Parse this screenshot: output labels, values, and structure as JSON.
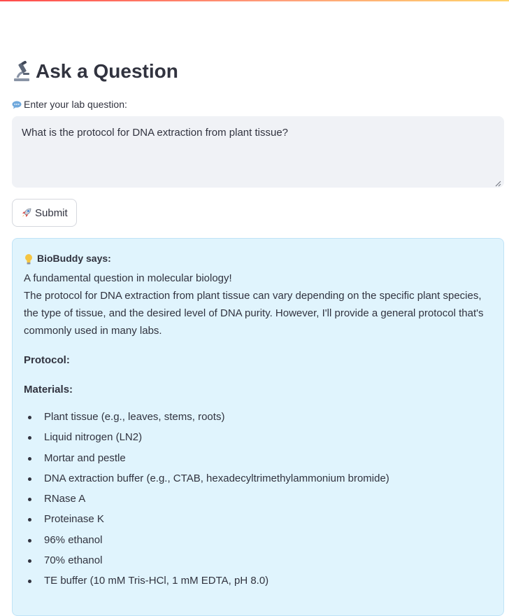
{
  "page": {
    "title": "Ask a Question",
    "title_icon": "microscope-icon"
  },
  "question_input": {
    "label": "Enter your lab question:",
    "label_icon": "speech-bubble-icon",
    "value": "What is the protocol for DNA extraction from plant tissue?"
  },
  "submit_button": {
    "label": "Submit",
    "icon": "rocket-icon"
  },
  "response": {
    "icon": "lightbulb-icon",
    "speaker": "BioBuddy says:",
    "intro": "A fundamental question in molecular biology!",
    "body": "The protocol for DNA extraction from plant tissue can vary depending on the specific plant species, the type of tissue, and the desired level of DNA purity. However, I'll provide a general protocol that's commonly used in many labs.",
    "protocol_heading": "Protocol:",
    "materials_heading": "Materials:",
    "materials": [
      "Plant tissue (e.g., leaves, stems, roots)",
      "Liquid nitrogen (LN2)",
      "Mortar and pestle",
      "DNA extraction buffer (e.g., CTAB, hexadecyltrimethylammonium bromide)",
      "RNase A",
      "Proteinase K",
      "96% ethanol",
      "70% ethanol",
      "TE buffer (10 mM Tris-HCl, 1 mM EDTA, pH 8.0)"
    ]
  },
  "colors": {
    "accent_gradient_start": "#ff4b4b",
    "accent_gradient_end": "#ffd36b",
    "input_background": "#f0f2f6",
    "response_background": "#e0f4fd",
    "response_border": "#bfe3f7",
    "text": "#31333f"
  }
}
